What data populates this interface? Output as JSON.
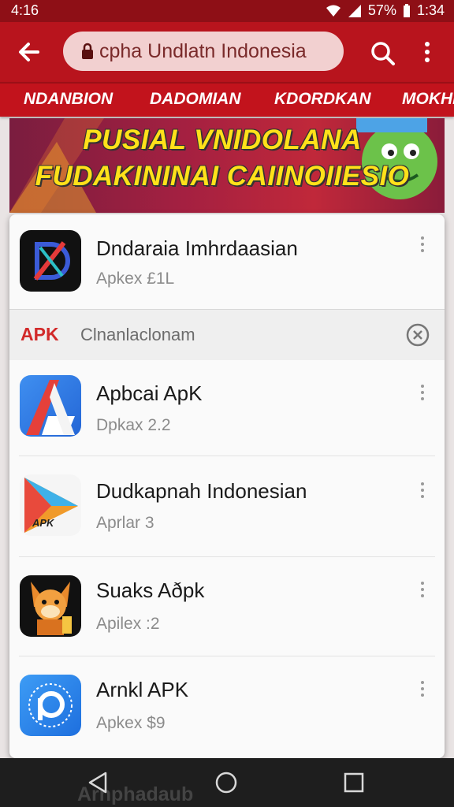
{
  "status_bar": {
    "time": "4:16",
    "battery": "57%",
    "clock_right": "1:34"
  },
  "browser": {
    "url": "cpha Undlatn Indonesia",
    "icons": {
      "back": "back-arrow-icon",
      "lock": "lock-icon",
      "search": "search-icon",
      "more": "more-vert-icon"
    }
  },
  "nav_tabs": [
    "NDANBION",
    "DADOMIAN",
    "KDORDKAN",
    "MOKHN"
  ],
  "banner": {
    "line1": "PUSIAL VNIDOLANA",
    "line2": "FUDAKININAI CAIINOIIESIO"
  },
  "top_result": {
    "title": "Dndaraia Imhrdaasian",
    "subtitle": "Apkex £1L",
    "icon": "d-logo-icon"
  },
  "section": {
    "tag": "APK",
    "title": "Clnanlaclonam",
    "clear_icon": "clear-icon"
  },
  "apps": [
    {
      "title": "Apbcai ApK",
      "subtitle": "Dpkax 2.2",
      "icon": "a-logo-icon"
    },
    {
      "title": "Dudkapnah Indonesian",
      "subtitle": "Aprlar 3",
      "icon": "play-apk-icon",
      "icon_text": "APK"
    },
    {
      "title": "Suaks Aðpk",
      "subtitle": "Apilex :2",
      "icon": "fox-mascot-icon"
    },
    {
      "title": "Arnkl APK",
      "subtitle": "Apkex $9",
      "icon": "p-logo-icon"
    }
  ],
  "background_text": "Arnphadaub",
  "colors": {
    "primary": "#b8141d",
    "status_bar": "#8e0f16",
    "accent_tag": "#d22a2a",
    "banner_text": "#ffe11a"
  }
}
